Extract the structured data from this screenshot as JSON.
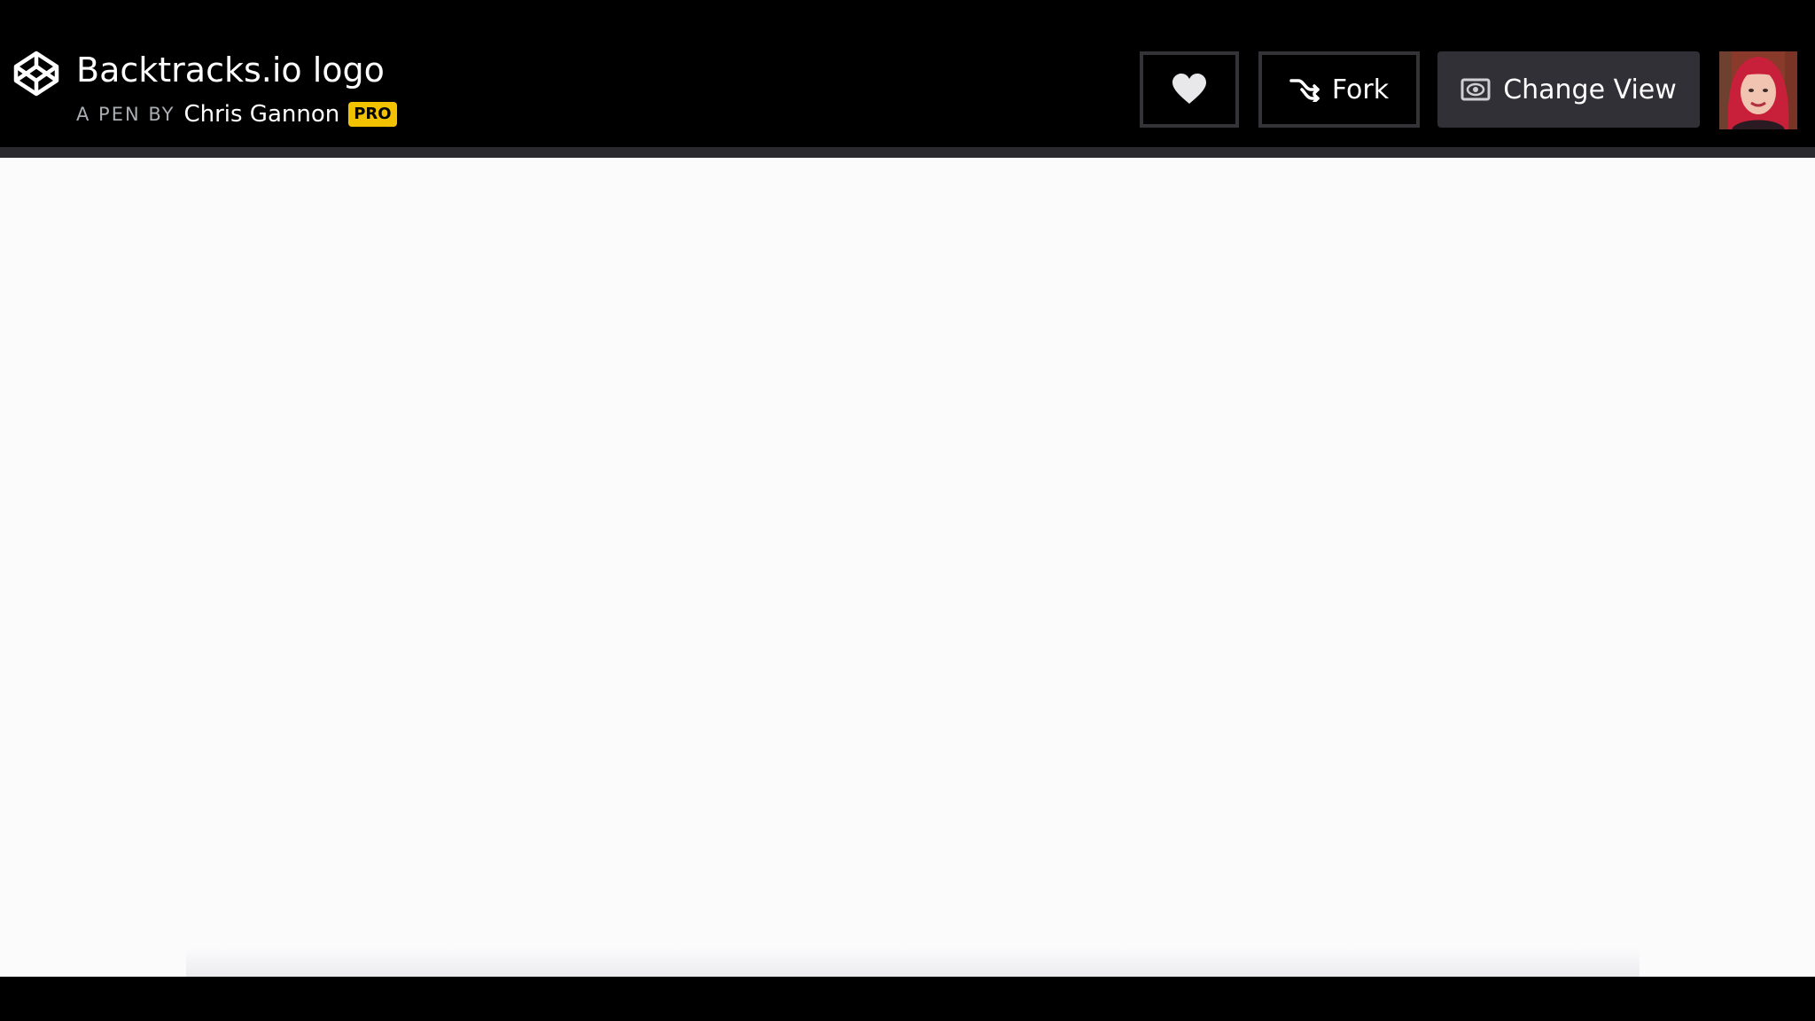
{
  "header": {
    "title": "Backtracks.io logo",
    "byline_prefix": "A PEN BY",
    "author": "Chris Gannon",
    "badge": "PRO",
    "logo_icon": "codepen-logo-icon"
  },
  "actions": {
    "like_icon": "heart-icon",
    "fork_label": "Fork",
    "fork_icon": "fork-icon",
    "change_view_label": "Change View",
    "change_view_icon": "eye-icon"
  },
  "colors": {
    "topbar_bg": "#000000",
    "preview_bg": "#fbfbfc",
    "pro_badge": "#f2c200",
    "button_border": "#333338",
    "change_view_bg": "#303036"
  }
}
